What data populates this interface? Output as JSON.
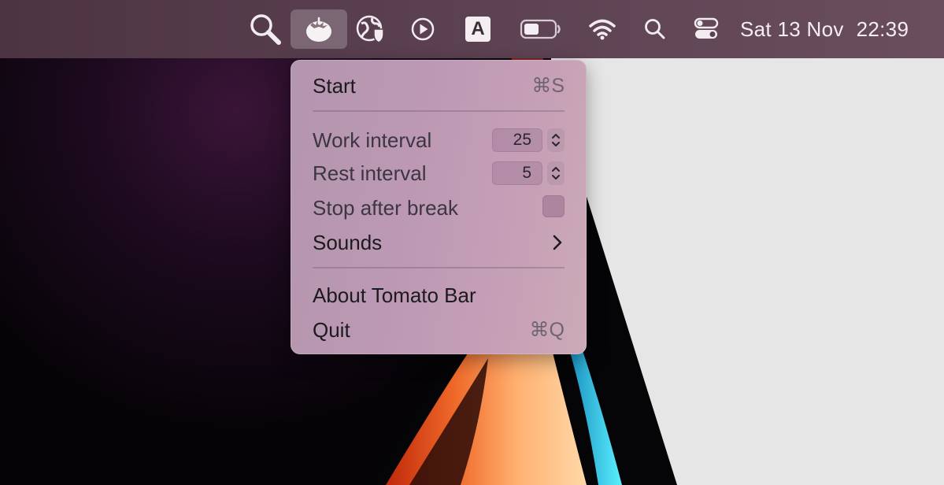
{
  "menubar": {
    "icons": [
      "magnifier-icon",
      "tomato-icon",
      "globe-shield-icon",
      "play-circle-icon",
      "input-source-icon",
      "battery-icon",
      "wifi-icon",
      "spotlight-icon",
      "control-center-icon"
    ],
    "input_source_letter": "A",
    "clock": {
      "date": "Sat 13 Nov",
      "time": "22:39"
    }
  },
  "menu": {
    "start": {
      "label": "Start",
      "shortcut": "⌘S"
    },
    "work_interval": {
      "label": "Work interval",
      "value": "25"
    },
    "rest_interval": {
      "label": "Rest interval",
      "value": "5"
    },
    "stop_after_break": {
      "label": "Stop after break",
      "checked": false
    },
    "sounds": {
      "label": "Sounds"
    },
    "about": {
      "label": "About Tomato Bar"
    },
    "quit": {
      "label": "Quit",
      "shortcut": "⌘Q"
    }
  },
  "colors": {
    "menubar": "#5a4050",
    "menu_background": "#bc98b4",
    "tomato_highlight": "#7a6270"
  }
}
